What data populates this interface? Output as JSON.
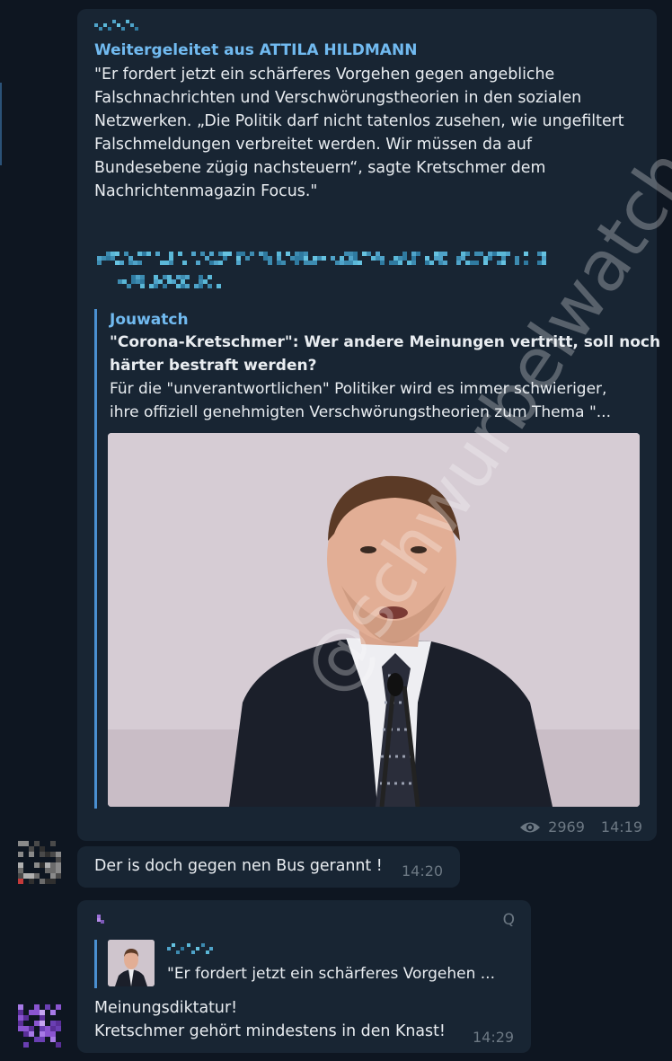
{
  "message1": {
    "forward_label": "Weitergeleitet aus ATTILA HILDMANN",
    "text_lines": [
      "\"Er fordert jetzt ein schärferes Vorgehen gegen angebliche",
      "Falschnachrichten und Verschwörungstheorien in den sozialen",
      "Netzwerken. „Die Politik darf nicht tatenlos zusehen, wie ungefiltert",
      "Falschmeldungen verbreitet werden. Wir müssen da auf",
      "Bundesebene zügig nachsteuern“, sagte Kretschmer dem",
      "Nachrichtenmagazin Focus.\""
    ],
    "preview": {
      "site": "Jouwatch",
      "title_lines": [
        "\"Corona-Kretschmer\": Wer andere Meinungen vertritt, soll noch",
        "härter bestraft werden?"
      ],
      "desc_lines": [
        "Für die \"unverantwortlichen\" Politiker wird es immer schwieriger,",
        "ihre offiziell genehmigten Verschwörungstheorien zum Thema \"..."
      ]
    },
    "views": "2969",
    "time": "14:19"
  },
  "message2": {
    "text": "Der is doch gegen nen Bus gerannt !",
    "time": "14:20"
  },
  "message3": {
    "reply_text": "\"Er fordert jetzt ein schärferes Vorgehen ...",
    "q_label": "Q",
    "lines": [
      "Meinungsdiktatur!",
      "Kretschmer gehört mindestens in den Knast!"
    ],
    "time": "14:29"
  },
  "watermark": "@schwurbelwatch",
  "colors": {
    "background": "#0e1621",
    "bubble": "#182533",
    "accent": "#71baf0",
    "meta": "#6c7883"
  },
  "icons": {
    "views": "eye-icon"
  }
}
